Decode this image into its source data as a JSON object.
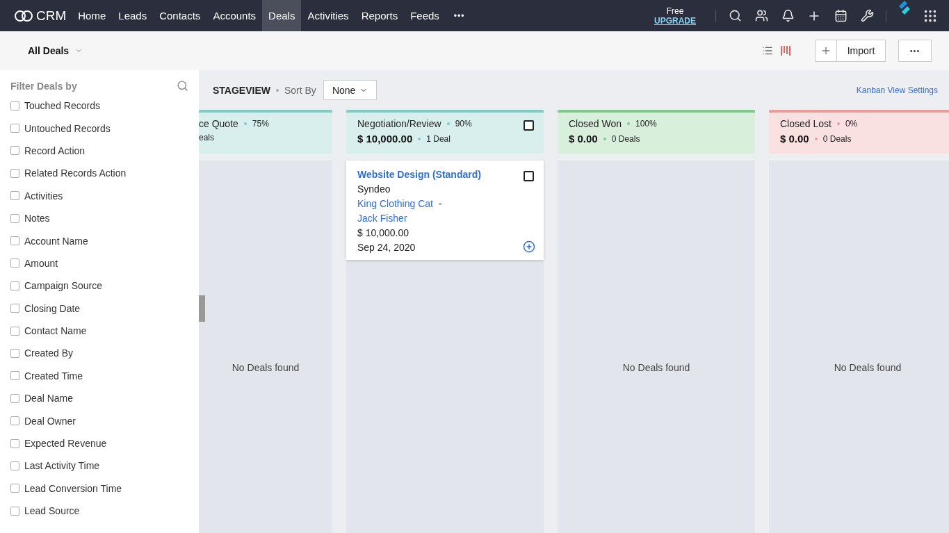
{
  "nav": {
    "logo": "CRM",
    "tabs": [
      {
        "label": "Home",
        "selected": false
      },
      {
        "label": "Leads",
        "selected": false
      },
      {
        "label": "Contacts",
        "selected": false
      },
      {
        "label": "Accounts",
        "selected": false
      },
      {
        "label": "Deals",
        "selected": true
      },
      {
        "label": "Activities",
        "selected": false
      },
      {
        "label": "Reports",
        "selected": false
      },
      {
        "label": "Feeds",
        "selected": false
      }
    ],
    "more": "•••",
    "plan": "Free",
    "upgrade": "UPGRADE"
  },
  "toolbar": {
    "view": "All Deals",
    "view_modes": [
      {
        "kind": "list",
        "selected": false
      },
      {
        "kind": "kanban",
        "selected": true
      }
    ],
    "import": "Import",
    "more": "•••"
  },
  "sidebar": {
    "title": "Filter Deals by",
    "filters": [
      {
        "label": "Touched Records",
        "checked": false
      },
      {
        "label": "Untouched Records",
        "checked": false
      },
      {
        "label": "Record Action",
        "checked": false
      },
      {
        "label": "Related Records Action",
        "checked": false
      },
      {
        "label": "Activities",
        "checked": false
      },
      {
        "label": "Notes",
        "checked": false
      },
      {
        "label": "Account Name",
        "checked": false
      },
      {
        "label": "Amount",
        "checked": false
      },
      {
        "label": "Campaign Source",
        "checked": false
      },
      {
        "label": "Closing Date",
        "checked": false
      },
      {
        "label": "Contact Name",
        "checked": false
      },
      {
        "label": "Created By",
        "checked": false
      },
      {
        "label": "Created Time",
        "checked": false
      },
      {
        "label": "Deal Name",
        "checked": false
      },
      {
        "label": "Deal Owner",
        "checked": false
      },
      {
        "label": "Expected Revenue",
        "checked": false
      },
      {
        "label": "Last Activity Time",
        "checked": false
      },
      {
        "label": "Lead Conversion Time",
        "checked": false
      },
      {
        "label": "Lead Source",
        "checked": false
      }
    ]
  },
  "board": {
    "title": "STAGEVIEW",
    "sort_label": "Sort By",
    "sort_value": "None",
    "settings_link": "Kanban View Settings",
    "columns": [
      {
        "name": "ce Quote",
        "percent": "75%",
        "count": "eals",
        "color": "#7fcbc6",
        "empty_text": "No Deals found"
      },
      {
        "name": "Negotiation/Review",
        "percent": "90%",
        "amount": "$ 10,000.00",
        "count": "1 Deal",
        "color": "#7fcbc6",
        "checkbox": {
          "checked": false
        },
        "cards": [
          {
            "title": "Website Design (Standard)",
            "account": "Syndeo",
            "contact": "King Clothing Cat",
            "separator": "-",
            "owner": "Jack Fisher",
            "amount": "$ 10,000.00",
            "date": "Sep 24, 2020",
            "checked": false
          }
        ]
      },
      {
        "name": "Closed Won",
        "percent": "100%",
        "amount": "$ 0.00",
        "count": "0 Deals",
        "color": "#7cc98a",
        "empty_text": "No Deals found"
      },
      {
        "name": "Closed Lost",
        "percent": "0%",
        "amount": "$ 0.00",
        "count": "0 Deals",
        "color": "#ef9a9a",
        "empty_text": "No Deals found"
      }
    ]
  }
}
